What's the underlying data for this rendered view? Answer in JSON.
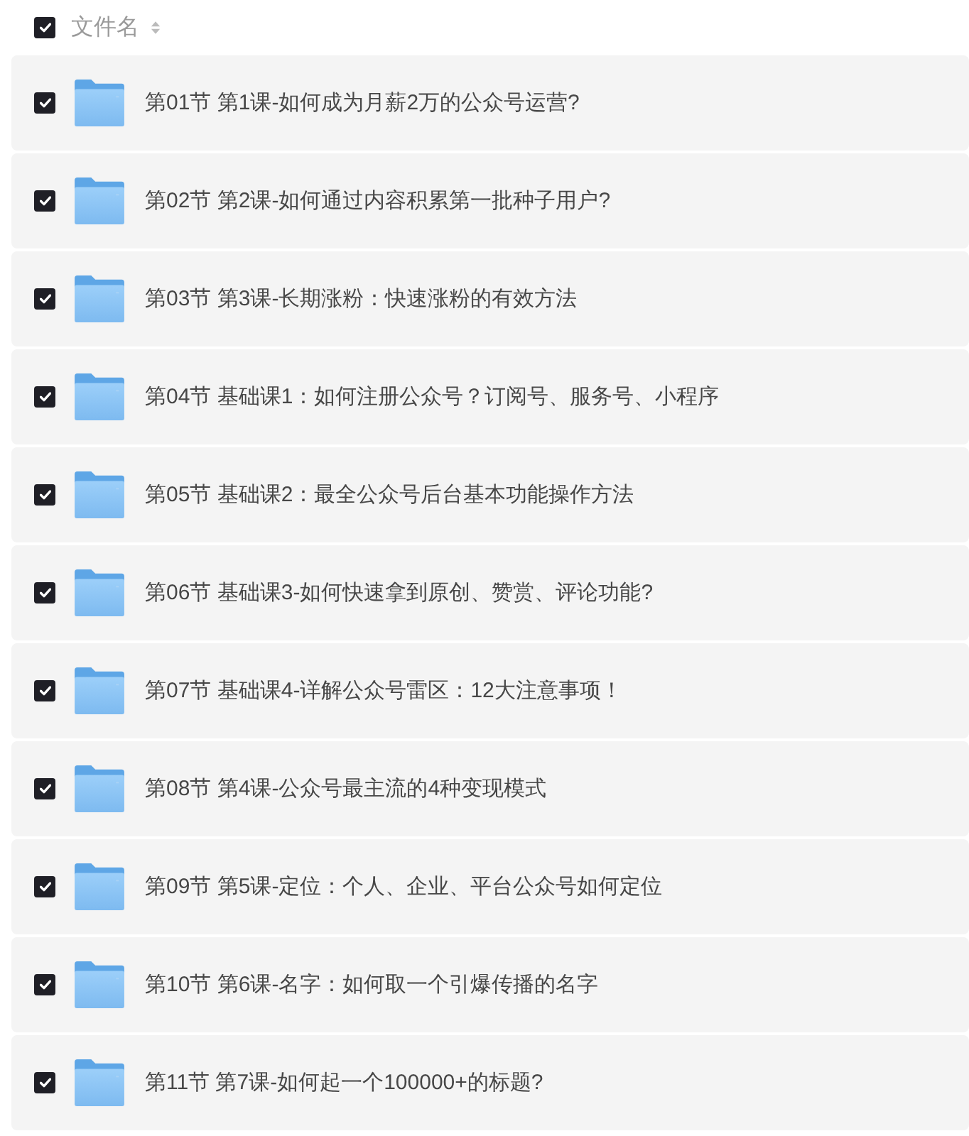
{
  "header": {
    "checked": true,
    "label": "文件名"
  },
  "files": [
    {
      "name": "第01节 第1课-如何成为月薪2万的公众号运营?",
      "checked": true
    },
    {
      "name": "第02节 第2课-如何通过内容积累第一批种子用户?",
      "checked": true
    },
    {
      "name": "第03节 第3课-长期涨粉：快速涨粉的有效方法",
      "checked": true
    },
    {
      "name": "第04节 基础课1：如何注册公众号？订阅号、服务号、小程序",
      "checked": true
    },
    {
      "name": "第05节 基础课2：最全公众号后台基本功能操作方法",
      "checked": true
    },
    {
      "name": "第06节 基础课3-如何快速拿到原创、赞赏、评论功能?",
      "checked": true
    },
    {
      "name": "第07节 基础课4-详解公众号雷区：12大注意事项！",
      "checked": true
    },
    {
      "name": "第08节 第4课-公众号最主流的4种变现模式",
      "checked": true
    },
    {
      "name": "第09节 第5课-定位：个人、企业、平台公众号如何定位",
      "checked": true
    },
    {
      "name": "第10节 第6课-名字：如何取一个引爆传播的名字",
      "checked": true
    },
    {
      "name": "第11节 第7课-如何起一个100000+的标题?",
      "checked": true
    }
  ]
}
